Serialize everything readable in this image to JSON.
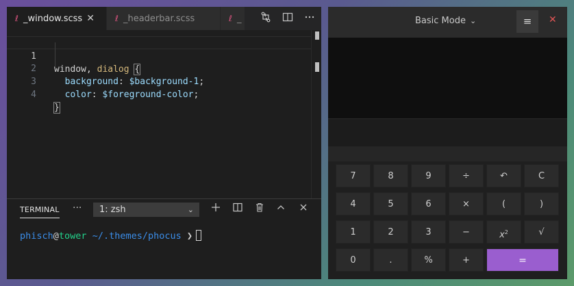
{
  "editor": {
    "tabs": [
      {
        "label": "_window.scss",
        "active": true,
        "close": "✕"
      },
      {
        "label": "_headerbar.scss",
        "active": false
      },
      {
        "label": "_",
        "active": false
      }
    ],
    "tab_icon_glyph": "ℓ",
    "actions": [
      "source-control-compare-icon",
      "split-editor-icon",
      "more-actions-icon"
    ],
    "line_numbers": [
      "1",
      "2",
      "3",
      "4"
    ],
    "code": {
      "line1": {
        "selector1": "window",
        "comma": ",",
        "selector2": "dialog",
        "brace": "{"
      },
      "line2": {
        "prop": "background",
        "colon": ":",
        "value": "$background-1",
        "semi": ";"
      },
      "line3": {
        "prop": "color",
        "colon": ":",
        "value": "$foreground-color",
        "semi": ";"
      },
      "line4": {
        "brace": "}"
      }
    }
  },
  "terminal": {
    "title": "TERMINAL",
    "more": "···",
    "shell_select": "1: zsh",
    "prompt": {
      "user": "phisch",
      "at": "@",
      "host": "tower",
      "path": "~/.themes/phocus",
      "arrow": "❯"
    }
  },
  "calculator": {
    "mode": "Basic Mode",
    "rows": [
      [
        "7",
        "8",
        "9",
        "÷",
        "↶",
        "C"
      ],
      [
        "4",
        "5",
        "6",
        "×",
        "(",
        ")"
      ],
      [
        "1",
        "2",
        "3",
        "−",
        "x2",
        "√"
      ],
      [
        "0",
        ".",
        "%",
        "+",
        "="
      ]
    ],
    "accent": "#9a5ecf"
  },
  "colors": {
    "selector": "#d7ba7d",
    "property": "#9cdcfe",
    "prompt_user": "#3b8eea",
    "prompt_host": "#23d18b",
    "close": "#e05555"
  }
}
